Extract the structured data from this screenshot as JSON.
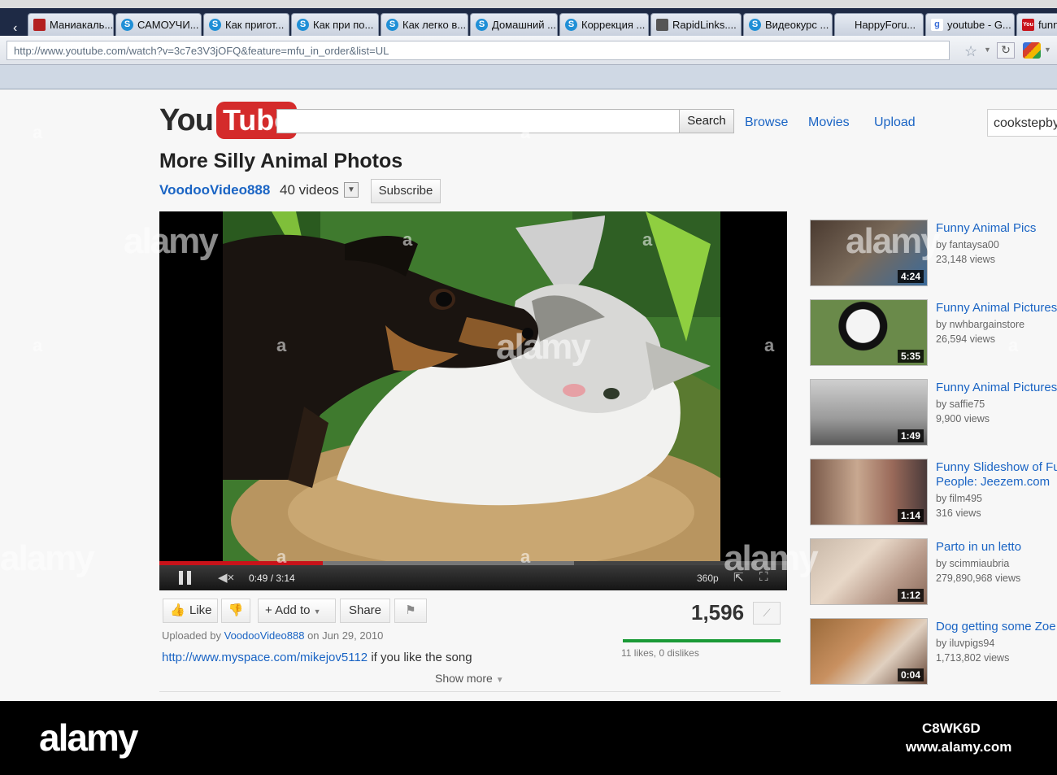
{
  "browser": {
    "tabs": [
      {
        "label": "Маниакаль...",
        "icon": "red"
      },
      {
        "label": "САМОУЧИ...",
        "icon": "skype"
      },
      {
        "label": "Как пригот...",
        "icon": "skype"
      },
      {
        "label": "Как при по...",
        "icon": "skype"
      },
      {
        "label": "Как легко в...",
        "icon": "skype"
      },
      {
        "label": "Домашний ...",
        "icon": "skype"
      },
      {
        "label": "Коррекция ...",
        "icon": "skype"
      },
      {
        "label": "RapidLinks....",
        "icon": "grey"
      },
      {
        "label": "Видеокурс ...",
        "icon": "skype"
      },
      {
        "label": "HappyForu...",
        "icon": "none"
      },
      {
        "label": "youtube - G...",
        "icon": "google"
      },
      {
        "label": "funn",
        "icon": "youtube"
      }
    ],
    "url": "http://www.youtube.com/watch?v=3c7e3V3jOFQ&feature=mfu_in_order&list=UL"
  },
  "header": {
    "logo_you": "You",
    "logo_tube": "Tube",
    "search_value": "",
    "search_label": "Search",
    "nav": {
      "browse": "Browse",
      "movies": "Movies",
      "upload": "Upload"
    },
    "username": "cookstepby"
  },
  "video": {
    "title": "More Silly Animal Photos",
    "channel": "VoodooVideo888",
    "video_count": "40 videos",
    "subscribe_label": "Subscribe",
    "time": "0:49 / 3:14",
    "quality": "360p",
    "progress_fraction": 0.26,
    "buffered_fraction": 0.66
  },
  "actions": {
    "like": "Like",
    "add_to": "Add to",
    "share": "Share",
    "views": "1,596",
    "like_stats": "11 likes, 0 dislikes"
  },
  "info": {
    "uploaded_prefix": "Uploaded by",
    "uploader": "VoodooVideo888",
    "uploaded_date": "on Jun 29, 2010",
    "desc_link": "http://www.myspace.com/mikejov5112",
    "desc_text": "if you like the song",
    "show_more": "Show more"
  },
  "related": [
    {
      "title": "Funny Animal Pics",
      "by": "by fantaysa00",
      "views": "23,148 views",
      "duration": "4:24"
    },
    {
      "title": "Funny Animal Pictures",
      "by": "by nwhbargainstore",
      "views": "26,594 views",
      "duration": "5:35"
    },
    {
      "title": "Funny Animal Pictures",
      "by": "by saffie75",
      "views": "9,900 views",
      "duration": "1:49"
    },
    {
      "title": "Funny Slideshow of Fu",
      "title2": "People: Jeezem.com",
      "by": "by film495",
      "views": "316 views",
      "duration": "1:14"
    },
    {
      "title": "Parto in un letto",
      "by": "by scimmiaubria",
      "views": "279,890,968 views",
      "duration": "1:12"
    },
    {
      "title": "Dog getting some Zoe",
      "by": "by iluvpigs94",
      "views": "1,713,802 views",
      "duration": "0:04"
    }
  ],
  "watermark": {
    "text": "alamy",
    "letter": "a"
  },
  "stock": {
    "logo": "alamy",
    "id": "C8WK6D",
    "url": "www.alamy.com"
  }
}
